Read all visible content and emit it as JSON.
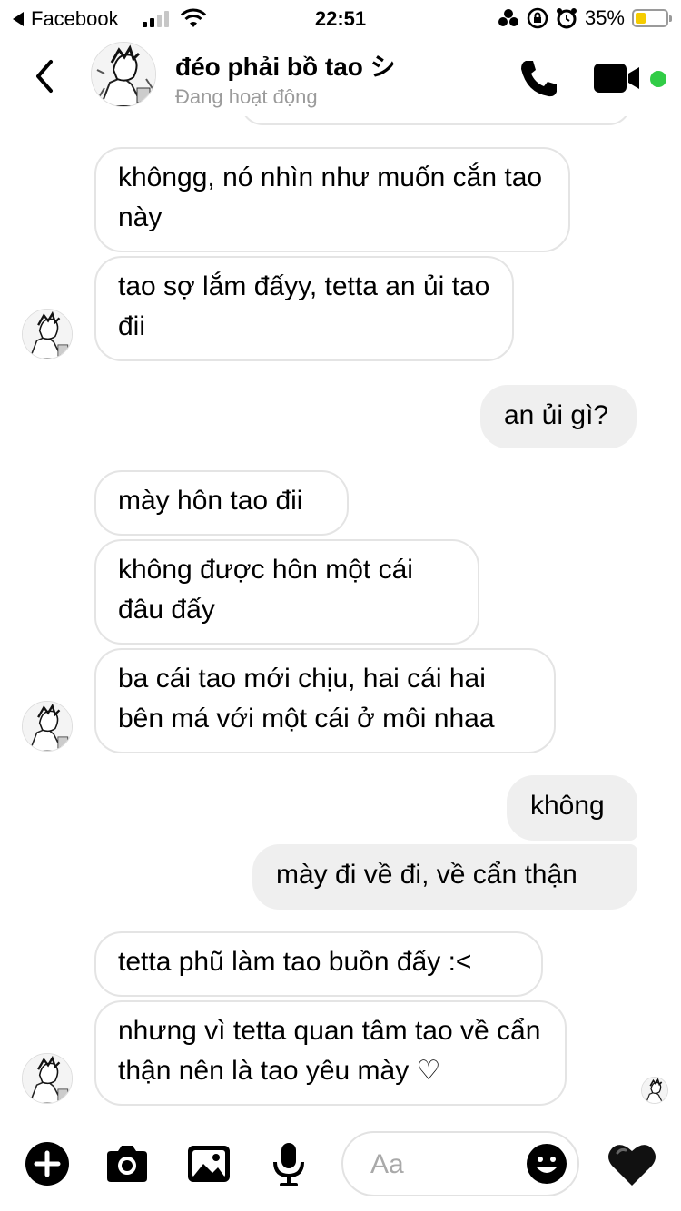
{
  "status_bar": {
    "back_app": "Facebook",
    "time": "22:51",
    "battery_percent": "35%",
    "battery_level": 0.35,
    "battery_color": "#f5cc00"
  },
  "header": {
    "title": "đéo phải bồ tao シ",
    "subtitle": "Đang hoạt động",
    "online_color": "#31cc46"
  },
  "messages": [
    {
      "side": "incoming",
      "text": "khôngg, nó nhìn như muốn cắn tao này"
    },
    {
      "side": "incoming",
      "text": "tao sợ lắm đấyy, tetta an ủi tao đii"
    },
    {
      "side": "outgoing",
      "text": "an ủi gì?"
    },
    {
      "side": "incoming",
      "text": "mày hôn tao đii"
    },
    {
      "side": "incoming",
      "text": "không được hôn một cái đâu đấy"
    },
    {
      "side": "incoming",
      "text": "ba cái tao mới chịu, hai cái hai bên má với một cái ở môi nhaa"
    },
    {
      "side": "outgoing",
      "text": "không"
    },
    {
      "side": "outgoing",
      "text": "mày đi về đi, về cẩn thận"
    },
    {
      "side": "incoming",
      "text": "tetta phũ làm tao buồn đấy :<"
    },
    {
      "side": "incoming",
      "text": "nhưng vì tetta quan tâm tao về cẩn thận nên là tao yêu mày ♡"
    }
  ],
  "composer": {
    "placeholder": "Aa",
    "icons": [
      "add-icon",
      "camera-icon",
      "gallery-icon",
      "microphone-icon",
      "emoji-icon",
      "heart-icon"
    ]
  }
}
